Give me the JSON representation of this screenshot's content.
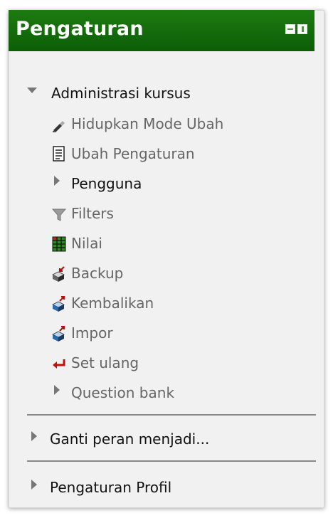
{
  "block": {
    "title": "Pengaturan",
    "header_color": "#0c5e06",
    "header_icons": [
      "dock-icon",
      "move-icon"
    ]
  },
  "admin": {
    "label": "Administrasi kursus",
    "expanded": true,
    "items": [
      {
        "label": "Hidupkan Mode Ubah",
        "icon": "edit-pencil-icon"
      },
      {
        "label": "Ubah Pengaturan",
        "icon": "settings-document-icon"
      },
      {
        "label": "Pengguna",
        "icon": "collapsed-arrow"
      },
      {
        "label": "Filters",
        "icon": "filter-funnel-icon"
      },
      {
        "label": "Nilai",
        "icon": "grades-spreadsheet-icon"
      },
      {
        "label": "Backup",
        "icon": "backup-box-icon"
      },
      {
        "label": "Kembalikan",
        "icon": "restore-box-icon"
      },
      {
        "label": "Impor",
        "icon": "import-box-icon"
      },
      {
        "label": "Set ulang",
        "icon": "reset-return-icon"
      },
      {
        "label": "Question bank",
        "icon": "collapsed-arrow"
      }
    ]
  },
  "switch_role": {
    "label": "Ganti peran menjadi..."
  },
  "profile_settings": {
    "label": "Pengaturan Profil"
  }
}
